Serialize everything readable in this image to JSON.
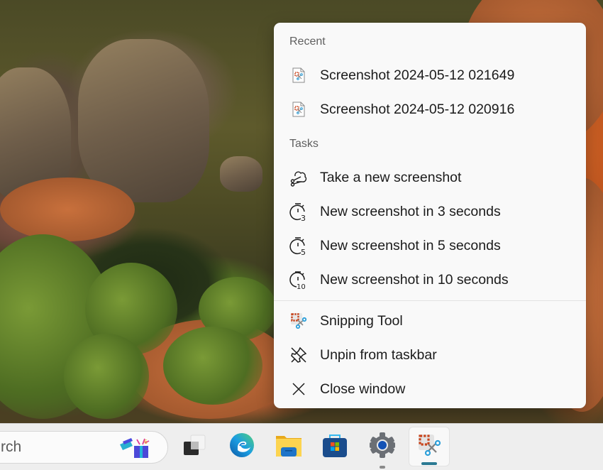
{
  "jumplist": {
    "sections": {
      "recent_label": "Recent",
      "tasks_label": "Tasks"
    },
    "recent": [
      {
        "label": "Screenshot 2024-05-12 021649",
        "icon": "image-file-icon"
      },
      {
        "label": "Screenshot 2024-05-12 020916",
        "icon": "image-file-icon"
      }
    ],
    "tasks": [
      {
        "label": "Take a new screenshot",
        "icon": "snip-shape-icon"
      },
      {
        "label": "New screenshot in 3 seconds",
        "icon": "timer-3-icon",
        "timer_digit": "3"
      },
      {
        "label": "New screenshot in 5 seconds",
        "icon": "timer-5-icon",
        "timer_digit": "5"
      },
      {
        "label": "New screenshot in 10 seconds",
        "icon": "timer-10-icon",
        "timer_digit": "10"
      }
    ],
    "app_actions": [
      {
        "label": "Snipping Tool",
        "icon": "snipping-tool-icon"
      },
      {
        "label": "Unpin from taskbar",
        "icon": "unpin-icon"
      },
      {
        "label": "Close window",
        "icon": "close-icon"
      }
    ]
  },
  "taskbar": {
    "search_text": "rch",
    "apps": [
      {
        "name": "Task View",
        "icon": "task-view-icon"
      },
      {
        "name": "Microsoft Edge",
        "icon": "edge-icon"
      },
      {
        "name": "File Explorer",
        "icon": "file-explorer-icon"
      },
      {
        "name": "Microsoft Store",
        "icon": "store-icon"
      },
      {
        "name": "Settings",
        "icon": "settings-icon",
        "running": true
      },
      {
        "name": "Snipping Tool",
        "icon": "snipping-tool-icon",
        "running": true,
        "active": true
      }
    ]
  },
  "colors": {
    "menu_bg": "#f9f9f9",
    "taskbar_bg": "#eeeeee",
    "active_indicator": "#2b7a93",
    "snip_red": "#c8441c",
    "snip_blue": "#2d9fd9"
  }
}
